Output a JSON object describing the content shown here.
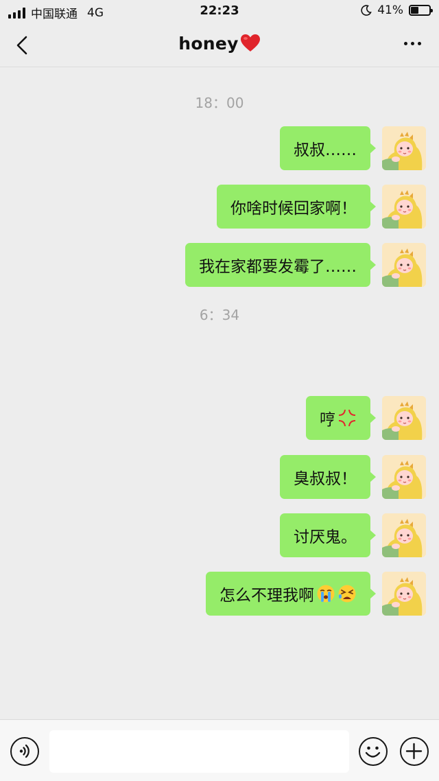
{
  "status_bar": {
    "carrier": "中国联通",
    "network": "4G",
    "time": "22:23",
    "battery_percent": "41%",
    "battery_level": 0.41,
    "icons": [
      "signal-icon",
      "moon-icon",
      "battery-icon"
    ]
  },
  "nav": {
    "title": "honey",
    "title_emoji": "heart-icon",
    "back_icon": "back-chevron-icon",
    "more_icon": "more-dots-icon"
  },
  "chat": {
    "timestamps": [
      "18：00",
      "6：34"
    ],
    "messages": [
      {
        "text": "叔叔……",
        "emojis": []
      },
      {
        "text": "你啥时候回家啊！",
        "emojis": []
      },
      {
        "text": "我在家都要发霉了……",
        "emojis": []
      },
      {
        "text": "哼",
        "emojis": [
          "anger-icon"
        ]
      },
      {
        "text": "臭叔叔！",
        "emojis": []
      },
      {
        "text": "讨厌鬼。",
        "emojis": []
      },
      {
        "text": "怎么不理我啊",
        "emojis": [
          "crying-face-icon",
          "tired-face-icon"
        ]
      }
    ],
    "sender": "self",
    "bubble_color": "#95ec69",
    "avatar": "dinosaur-costume-girl-avatar"
  },
  "input_bar": {
    "value": "",
    "voice_icon": "voice-icon",
    "emoji_icon": "smiley-icon",
    "plus_icon": "plus-icon"
  },
  "colors": {
    "background": "#ededed",
    "timestamp": "#a3a3a3",
    "bubble": "#95ec69"
  }
}
